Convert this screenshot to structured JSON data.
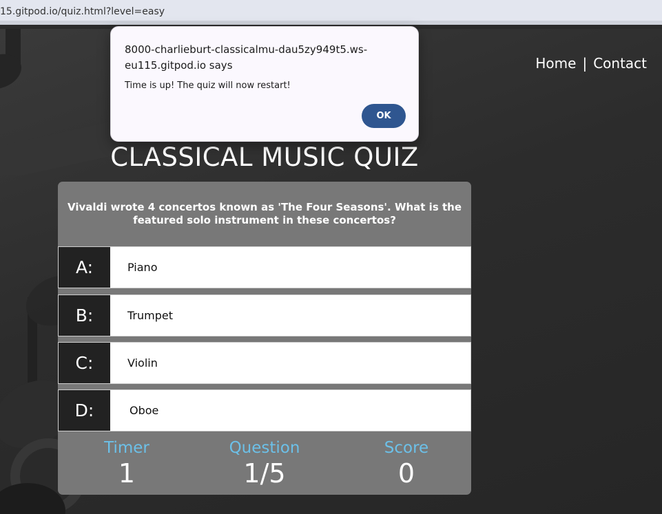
{
  "browser": {
    "url": "15.gitpod.io/quiz.html?level=easy"
  },
  "nav": {
    "home": "Home",
    "separator": "|",
    "contact": "Contact"
  },
  "title": "CLASSICAL MUSIC QUIZ",
  "quiz": {
    "question": "Vivaldi wrote 4 concertos known as 'The Four Seasons'. What is the featured solo instrument in these concertos?",
    "answers": [
      {
        "letter": "A:",
        "text": "Piano"
      },
      {
        "letter": "B:",
        "text": "Trumpet"
      },
      {
        "letter": "C:",
        "text": "Violin"
      },
      {
        "letter": "D:",
        "text": "Oboe"
      }
    ],
    "stats": {
      "timer_label": "Timer",
      "timer_value": "1",
      "question_label": "Question",
      "question_value": "1/5",
      "score_label": "Score",
      "score_value": "0"
    }
  },
  "dialog": {
    "origin": "8000-charlieburt-classicalmu-dau5zy949t5.ws-eu115.gitpod.io says",
    "message": "Time is up! The quiz will now restart!",
    "ok_label": "OK"
  },
  "colors": {
    "stat_label": "#6cc0e8",
    "card": "#787878",
    "letter_box": "#222222",
    "ok_button": "#2f5690"
  },
  "icons": [
    "music-note-icon"
  ]
}
